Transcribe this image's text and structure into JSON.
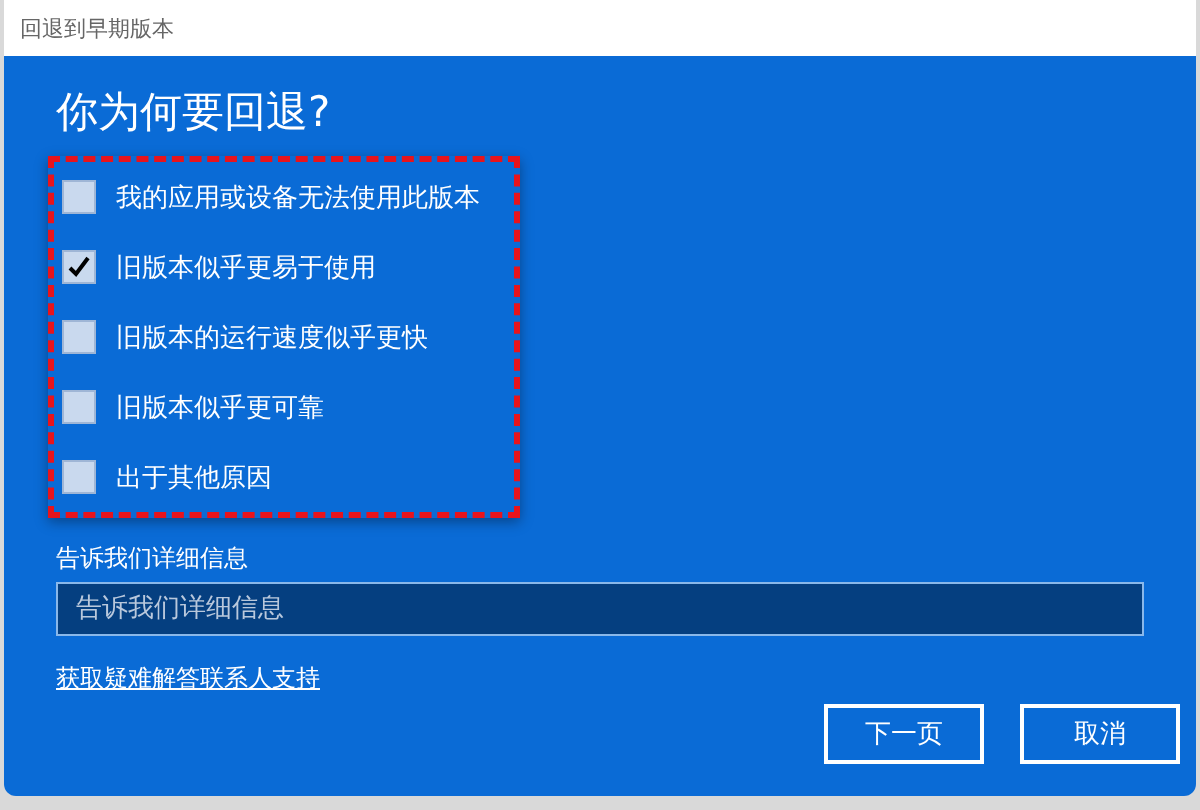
{
  "window": {
    "title": "回退到早期版本"
  },
  "heading": "你为何要回退?",
  "reasons": [
    {
      "label": "我的应用或设备无法使用此版本",
      "checked": false
    },
    {
      "label": "旧版本似乎更易于使用",
      "checked": true
    },
    {
      "label": "旧版本的运行速度似乎更快",
      "checked": false
    },
    {
      "label": "旧版本似乎更可靠",
      "checked": false
    },
    {
      "label": "出于其他原因",
      "checked": false
    }
  ],
  "details": {
    "label": "告诉我们详细信息",
    "placeholder": "告诉我们详细信息"
  },
  "support_link": "获取疑难解答联系人支持",
  "buttons": [
    "下一页",
    "取消"
  ]
}
